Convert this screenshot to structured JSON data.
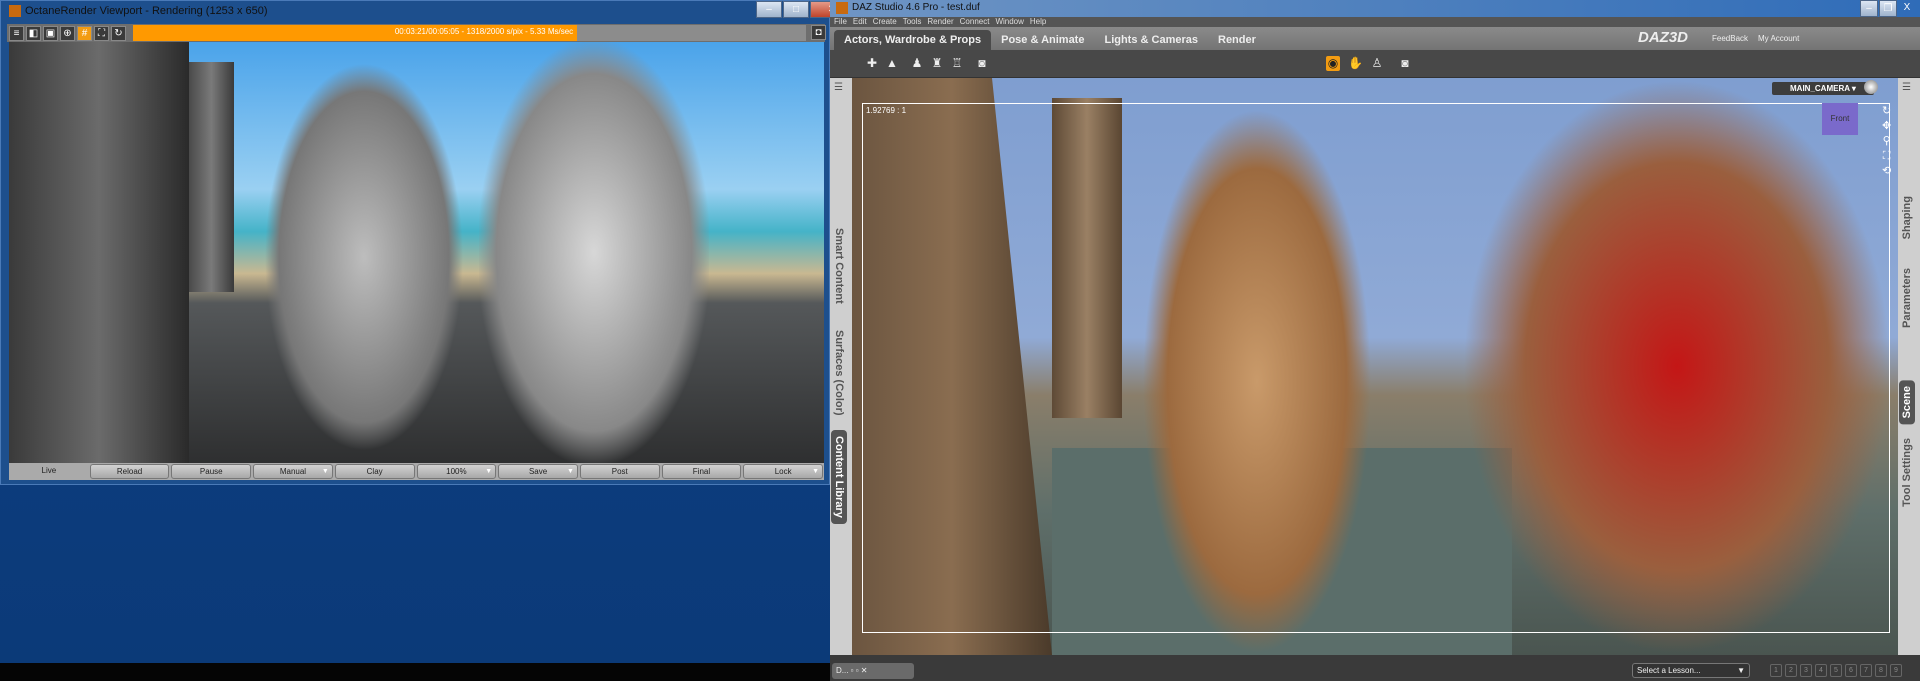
{
  "octane": {
    "title": "OctaneRender Viewport - Rendering (1253 x 650)",
    "status": "00:03:21/00:05:05 - 1318/2000 s/pix - 5.33 Ms/sec",
    "progress_percent": 66,
    "buttons": [
      {
        "label": "Live"
      },
      {
        "label": "Reload"
      },
      {
        "label": "Pause"
      },
      {
        "label": "Manual",
        "dropdown": true
      },
      {
        "label": "Clay"
      },
      {
        "label": "100%",
        "dropdown": true
      },
      {
        "label": "Save",
        "dropdown": true
      },
      {
        "label": "Post"
      },
      {
        "label": "Final"
      },
      {
        "label": "Lock",
        "dropdown": true
      }
    ]
  },
  "daz": {
    "title": "DAZ Studio 4.6 Pro - test.duf",
    "menu": [
      "File",
      "Edit",
      "Create",
      "Tools",
      "Render",
      "Connect",
      "Window",
      "Help"
    ],
    "tabs": [
      "Actors, Wardrobe & Props",
      "Pose & Animate",
      "Lights & Cameras",
      "Render"
    ],
    "logo": "DAZ3D",
    "feedback": "FeedBack",
    "account": "My Account",
    "left_tabs": [
      "Smart Content",
      "Surfaces (Color)",
      "Content Library"
    ],
    "right_tabs": [
      "Shaping",
      "Parameters",
      "Scene",
      "Tool Settings"
    ],
    "aspect_ratio": "1.92769 : 1",
    "camera": "MAIN_CAMERA",
    "cube_label": "Front",
    "taskbar_item": "D...",
    "lesson_placeholder": "Select a Lesson...",
    "lesson_steps": [
      "1",
      "2",
      "3",
      "4",
      "5",
      "6",
      "7",
      "8",
      "9"
    ]
  }
}
